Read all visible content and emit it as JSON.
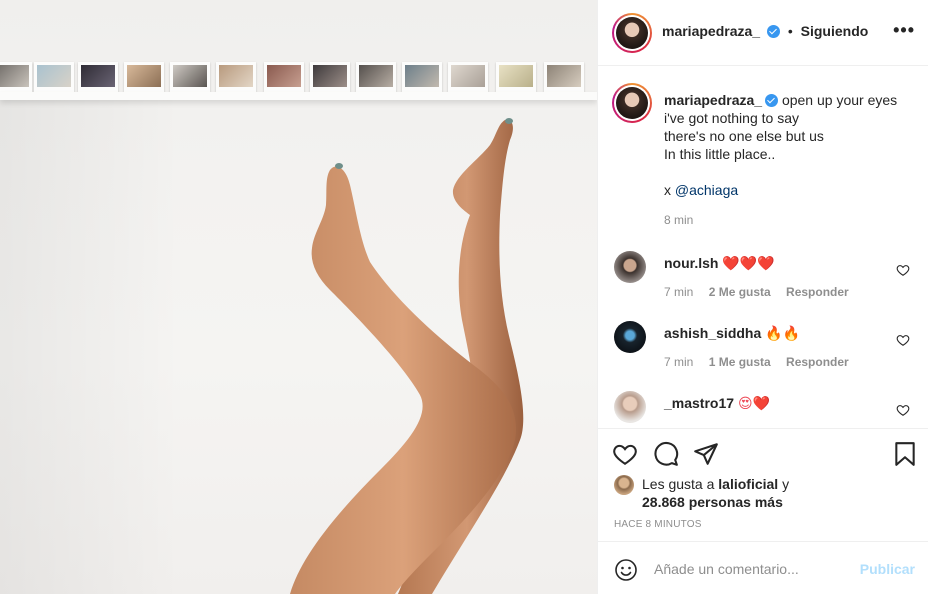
{
  "post": {
    "photo_alt": "",
    "header": {
      "username": "mariapedraza_",
      "separator": "•",
      "follow_status": "Siguiendo",
      "more_icon": "more-horizontal-icon"
    },
    "caption": {
      "username": "mariapedraza_",
      "lines": [
        "open up your eyes",
        "i've got nothing to say",
        "there's no one else but us",
        "In this little place.."
      ],
      "credit_prefix": "x ",
      "credit_mention": "@achiaga",
      "time": "8 min"
    },
    "comments": [
      {
        "username": "nour.lsh",
        "text": "❤️❤️❤️",
        "time": "7 min",
        "likes": "2 Me gusta",
        "reply": "Responder"
      },
      {
        "username": "ashish_siddha",
        "text": "🔥🔥",
        "time": "7 min",
        "likes": "1 Me gusta",
        "reply": "Responder"
      },
      {
        "username": "_mastro17",
        "text": "😍❤️"
      }
    ],
    "actions": {
      "like_icon": "heart-icon",
      "comment_icon": "comment-icon",
      "share_icon": "send-icon",
      "save_icon": "bookmark-icon"
    },
    "likes": {
      "prefix": "Les gusta a",
      "user": "lalioficial",
      "conj": "y",
      "count": "28.868 personas más"
    },
    "timestamp": "HACE 8 MINUTOS",
    "comment_box": {
      "emoji_icon": "smile-icon",
      "placeholder": "Añade un comentario...",
      "publish_label": "Publicar"
    }
  },
  "colors": {
    "verified": "#3897f0",
    "publish_disabled": "#b2dffc",
    "heart_red": "#ed4956",
    "mention": "#003569"
  }
}
